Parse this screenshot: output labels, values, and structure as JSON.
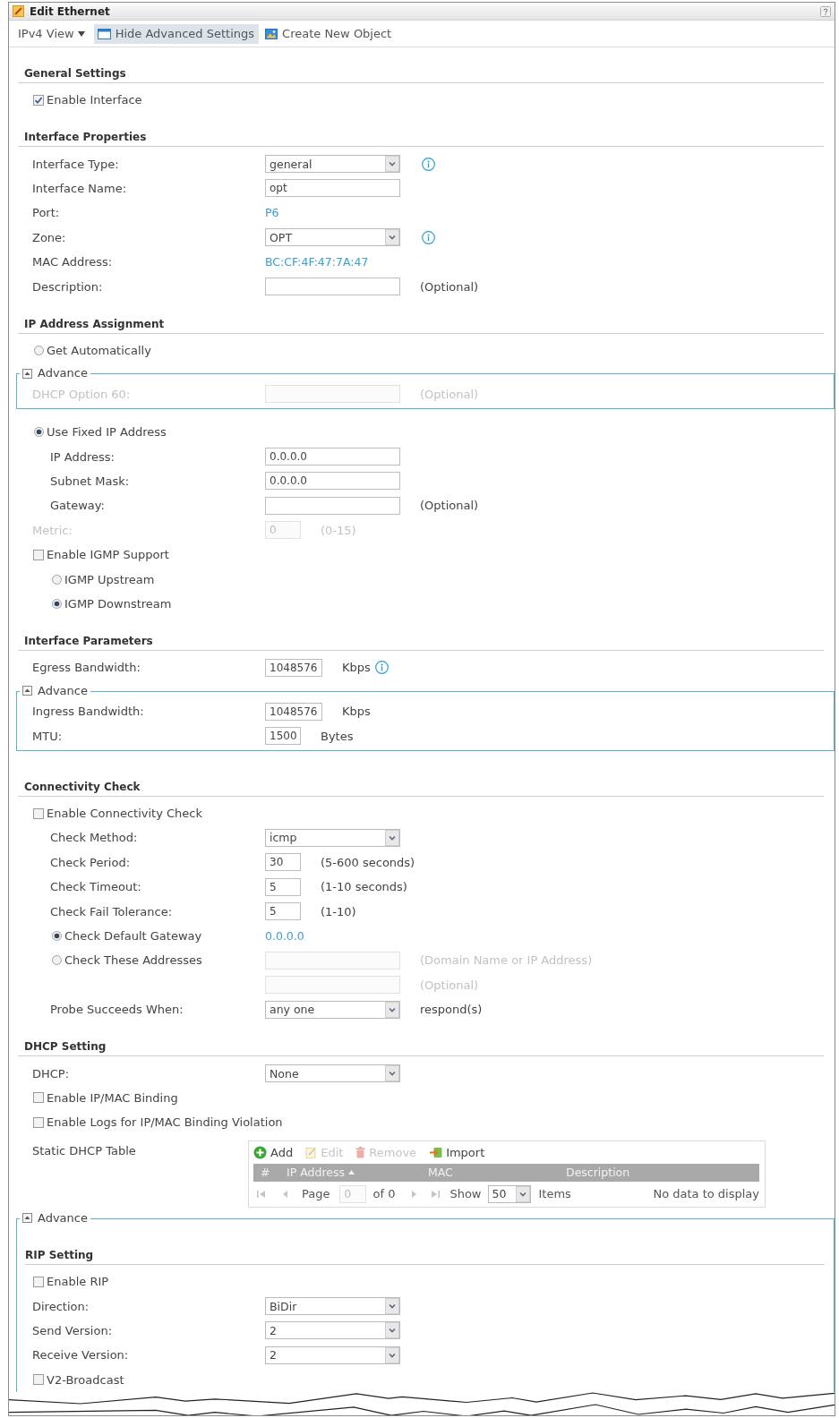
{
  "window": {
    "title": "Edit Ethernet"
  },
  "toolbar": [
    {
      "kind": "menu",
      "label": "IPv4 View"
    },
    {
      "kind": "toggle",
      "label": "Hide Advanced Settings",
      "pressed": true
    },
    {
      "kind": "create",
      "label": "Create New Object",
      "pressed": false
    }
  ],
  "sections": [
    {
      "kind": "section",
      "title": "General Settings",
      "rows": [
        {
          "kind": "checkbox",
          "label": "Enable Interface",
          "checked": true
        }
      ]
    },
    {
      "kind": "section",
      "title": "Interface Properties",
      "rows": [
        {
          "kind": "field",
          "label": "Interface Type:",
          "control": {
            "kind": "select",
            "value": "general",
            "disabled": false
          },
          "info": true
        },
        {
          "kind": "field",
          "label": "Interface Name:",
          "control": {
            "kind": "input",
            "value": "opt",
            "disabled": false
          }
        },
        {
          "kind": "field",
          "label": "Port:",
          "control": {
            "kind": "value",
            "value": "P6"
          }
        },
        {
          "kind": "field",
          "label": "Zone:",
          "control": {
            "kind": "select",
            "value": "OPT",
            "disabled": false
          },
          "info": true
        },
        {
          "kind": "field",
          "label": "MAC Address:",
          "control": {
            "kind": "value",
            "value": "BC:CF:4F:47:7A:47"
          }
        },
        {
          "kind": "field",
          "label": "Description:",
          "control": {
            "kind": "input",
            "disabled": false
          },
          "note": "(Optional)"
        }
      ]
    },
    {
      "kind": "section",
      "title": "IP Address Assignment",
      "rows": [
        {
          "kind": "radio",
          "label": "Get Automatically",
          "selected": false
        },
        {
          "kind": "advance",
          "legend": "Advance",
          "expanded": true,
          "rows": [
            {
              "kind": "field",
              "label": "DHCP Option 60:",
              "control": {
                "kind": "input",
                "disabled": true
              },
              "note": "(Optional)"
            }
          ]
        },
        {
          "kind": "radio",
          "label": "Use Fixed IP Address",
          "selected": true,
          "children": [
            {
              "kind": "field",
              "label": "IP Address:",
              "control": {
                "kind": "input",
                "value": "0.0.0.0",
                "disabled": false
              }
            },
            {
              "kind": "field",
              "label": "Subnet Mask:",
              "control": {
                "kind": "input",
                "value": "0.0.0.0",
                "disabled": false
              }
            },
            {
              "kind": "field",
              "label": "Gateway:",
              "control": {
                "kind": "input",
                "disabled": false
              },
              "note": "(Optional)"
            }
          ]
        },
        {
          "kind": "field",
          "label": "Metric:",
          "control": {
            "kind": "number",
            "value": "0",
            "disabled": true
          },
          "note": "(0-15)"
        },
        {
          "kind": "checkbox",
          "label": "Enable IGMP Support",
          "checked": false,
          "children": [
            {
              "kind": "radio",
              "label": "IGMP Upstream",
              "selected": false
            },
            {
              "kind": "radio",
              "label": "IGMP Downstream",
              "selected": true
            }
          ]
        }
      ]
    },
    {
      "kind": "section",
      "title": "Interface Parameters",
      "rows": [
        {
          "kind": "field",
          "label": "Egress Bandwidth:",
          "control": {
            "kind": "number",
            "value": "1048576",
            "disabled": false
          },
          "note": "Kbps",
          "info": true
        },
        {
          "kind": "advance",
          "legend": "Advance",
          "expanded": true,
          "rows": [
            {
              "kind": "field",
              "label": "Ingress Bandwidth:",
              "control": {
                "kind": "number",
                "value": "1048576",
                "disabled": false
              },
              "note": "Kbps"
            },
            {
              "kind": "field",
              "label": "MTU:",
              "control": {
                "kind": "number",
                "value": "1500",
                "disabled": false
              },
              "note": "Bytes"
            }
          ]
        }
      ]
    },
    {
      "kind": "section",
      "title": "Connectivity Check",
      "rows": [
        {
          "kind": "checkbox",
          "label": "Enable Connectivity Check",
          "checked": false,
          "children": [
            {
              "kind": "field",
              "label": "Check Method:",
              "control": {
                "kind": "select",
                "value": "icmp",
                "disabled": false
              }
            },
            {
              "kind": "field",
              "label": "Check Period:",
              "control": {
                "kind": "number",
                "value": "30",
                "disabled": false
              },
              "note": "(5-600 seconds)"
            },
            {
              "kind": "field",
              "label": "Check Timeout:",
              "control": {
                "kind": "number",
                "value": "5",
                "disabled": false
              },
              "note": "(1-10 seconds)"
            },
            {
              "kind": "field",
              "label": "Check Fail Tolerance:",
              "control": {
                "kind": "number",
                "value": "5",
                "disabled": false
              },
              "note": "(1-10)"
            },
            {
              "kind": "radio",
              "label": "Check Default Gateway",
              "selected": true,
              "control": {
                "kind": "value",
                "value": "0.0.0.0"
              }
            },
            {
              "kind": "radio",
              "label": "Check These Addresses",
              "selected": false,
              "control": {
                "kind": "input",
                "disabled": true
              },
              "note": "(Domain Name or IP Address)"
            },
            {
              "kind": "field",
              "control": {
                "kind": "input",
                "disabled": true
              },
              "note": "(Optional)"
            },
            {
              "kind": "field",
              "label": "Probe Succeeds When:",
              "control": {
                "kind": "select",
                "value": "any one",
                "disabled": false
              },
              "note": "respond(s)"
            }
          ]
        }
      ]
    },
    {
      "kind": "section",
      "title": "DHCP Setting",
      "rows": [
        {
          "kind": "field",
          "label": "DHCP:",
          "control": {
            "kind": "select",
            "value": "None",
            "disabled": false
          }
        },
        {
          "kind": "checkbox",
          "label": "Enable IP/MAC Binding",
          "checked": false
        },
        {
          "kind": "checkbox",
          "label": "Enable Logs for IP/MAC Binding Violation",
          "checked": false
        },
        {
          "kind": "table",
          "label": "Static DHCP Table",
          "actions": [
            {
              "kind": "add",
              "label": "Add",
              "disabled": false
            },
            {
              "kind": "edit",
              "label": "Edit",
              "disabled": true
            },
            {
              "kind": "remove",
              "label": "Remove",
              "disabled": true
            },
            {
              "kind": "import",
              "label": "Import",
              "disabled": false
            }
          ],
          "columns": [
            {
              "label": "#",
              "sorted": false
            },
            {
              "label": "IP Address",
              "sorted": true
            },
            {
              "label": "MAC",
              "sorted": false
            },
            {
              "label": "Description",
              "sorted": false
            }
          ],
          "pager": {
            "disabled": true,
            "page_label": "Page",
            "page": "0",
            "total": "of 0",
            "show_label": "Show",
            "per_page": "50",
            "items_label": "Items",
            "message": "No data to display"
          }
        }
      ]
    },
    {
      "kind": "advance",
      "legend": "Advance",
      "expanded": true,
      "sections": [
        {
          "kind": "section",
          "title": "RIP Setting",
          "rows": [
            {
              "kind": "checkbox",
              "label": "Enable RIP",
              "checked": false
            },
            {
              "kind": "field",
              "label": "Direction:",
              "control": {
                "kind": "select",
                "value": "BiDir",
                "disabled": false
              }
            },
            {
              "kind": "field",
              "label": "Send Version:",
              "control": {
                "kind": "select",
                "value": "2",
                "disabled": false
              }
            },
            {
              "kind": "field",
              "label": "Receive Version:",
              "control": {
                "kind": "select",
                "value": "2",
                "disabled": false
              }
            },
            {
              "kind": "checkbox",
              "label": "V2-Broadcast",
              "checked": false
            }
          ]
        }
      ]
    }
  ]
}
